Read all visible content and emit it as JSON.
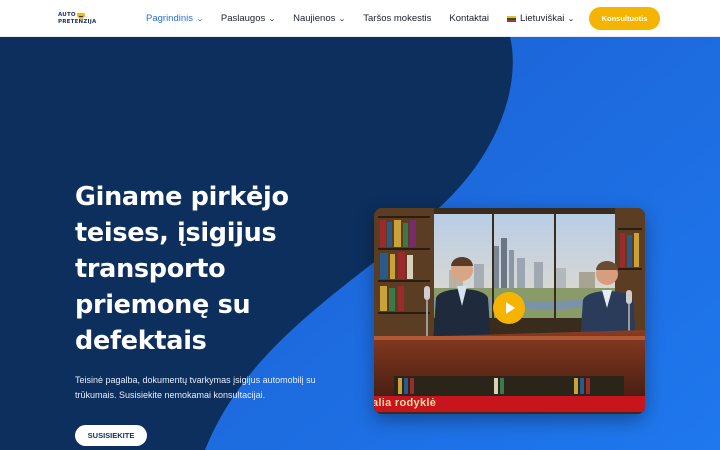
{
  "logo": {
    "line1": "AUTO",
    "line2": "PRETENZIJA"
  },
  "nav": {
    "items": [
      {
        "label": "Pagrindinis",
        "has_dropdown": true,
        "active": true
      },
      {
        "label": "Paslaugos",
        "has_dropdown": true,
        "active": false
      },
      {
        "label": "Naujienos",
        "has_dropdown": true,
        "active": false
      },
      {
        "label": "Taršos mokestis",
        "has_dropdown": false,
        "active": false
      },
      {
        "label": "Kontaktai",
        "has_dropdown": false,
        "active": false
      }
    ],
    "language": {
      "label": "Lietuviškai",
      "flag_colors": [
        "#fdb913",
        "#006a44",
        "#c1272d"
      ]
    },
    "cta_label": "Konsultuotis"
  },
  "hero": {
    "headline_lines": [
      "Giname pirkėjo",
      "teises, įsigijus",
      "transporto",
      "priemonę su",
      "defektais"
    ],
    "subtext": "Teisinė pagalba, dokumentų tvarkymas įsigijus automobilį su trūkumais. Susisiekite nemokamai konsultacijai.",
    "button_label": "SUSISIEKITE"
  },
  "video": {
    "ticker_text": "alia rodyklė",
    "play_icon": "play-icon"
  },
  "colors": {
    "header_bg": "#ffffff",
    "hero_dark": "#0d2f5e",
    "hero_blue": "#1f73e6",
    "accent": "#f5b400",
    "nav_active": "#2a6fd6"
  }
}
